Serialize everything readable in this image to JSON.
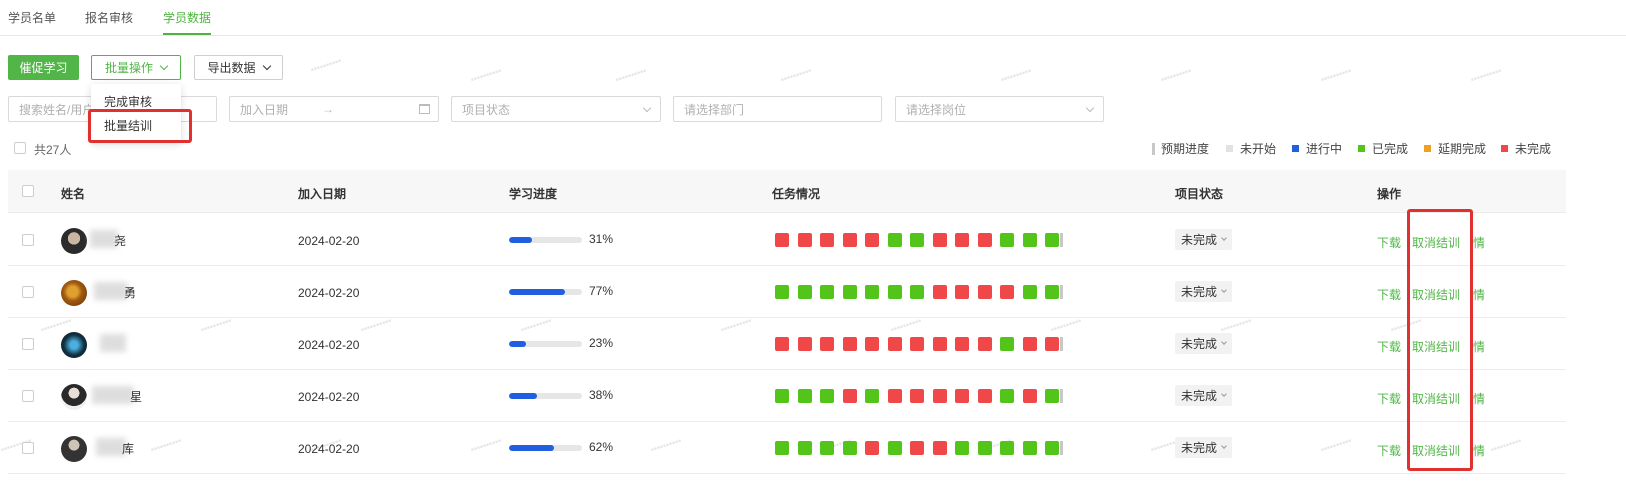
{
  "tabs": [
    {
      "label": "学员名单",
      "active": false
    },
    {
      "label": "报名审核",
      "active": false
    },
    {
      "label": "学员数据",
      "active": true
    }
  ],
  "toolbar": {
    "remind_label": "催促学习",
    "batch_label": "批量操作",
    "export_label": "导出数据"
  },
  "batch_menu": {
    "items": [
      "完成审核",
      "批量结训"
    ]
  },
  "filters": {
    "search_placeholder": "搜索姓名/用户",
    "date_placeholder": "加入日期",
    "date_separator": "→",
    "status_placeholder": "项目状态",
    "dept_placeholder": "请选择部门",
    "post_placeholder": "请选择岗位"
  },
  "summary": {
    "count_label": "共27人"
  },
  "legend": {
    "expected": "预期进度",
    "items": [
      {
        "label": "未开始",
        "color": "#e2e2e2"
      },
      {
        "label": "进行中",
        "color": "#1f5fe0"
      },
      {
        "label": "已完成",
        "color": "#52c41a"
      },
      {
        "label": "延期完成",
        "color": "#f0a020"
      },
      {
        "label": "未完成",
        "color": "#f04848"
      }
    ]
  },
  "colors": {
    "accent": "#52b548",
    "done": "#52c41a",
    "undone": "#f04848",
    "progress": "#1f5fe0",
    "highlight": "#e03030"
  },
  "table": {
    "columns": [
      "姓名",
      "加入日期",
      "学习进度",
      "任务情况",
      "项目状态",
      "操作"
    ],
    "rows": [
      {
        "name_suffix": "尧",
        "date": "2024-02-20",
        "progress": 31,
        "progress_label": "31%",
        "tasks": [
          "r",
          "r",
          "r",
          "r",
          "r",
          "g",
          "g",
          "r",
          "r",
          "r",
          "g",
          "g",
          "g"
        ],
        "status": "未完成",
        "actions": [
          "下载",
          "取消结训",
          "详情"
        ]
      },
      {
        "name_suffix": "勇",
        "date": "2024-02-20",
        "progress": 77,
        "progress_label": "77%",
        "tasks": [
          "g",
          "g",
          "g",
          "g",
          "g",
          "g",
          "g",
          "r",
          "r",
          "r",
          "r",
          "g",
          "g"
        ],
        "status": "未完成",
        "actions": [
          "下载",
          "取消结训",
          "详情"
        ]
      },
      {
        "name_suffix": "",
        "date": "2024-02-20",
        "progress": 23,
        "progress_label": "23%",
        "tasks": [
          "r",
          "r",
          "r",
          "r",
          "r",
          "r",
          "r",
          "r",
          "r",
          "r",
          "g",
          "r",
          "r"
        ],
        "status": "未完成",
        "actions": [
          "下载",
          "取消结训",
          "详情"
        ]
      },
      {
        "name_suffix": "星",
        "date": "2024-02-20",
        "progress": 38,
        "progress_label": "38%",
        "tasks": [
          "g",
          "g",
          "g",
          "r",
          "g",
          "r",
          "r",
          "r",
          "r",
          "r",
          "g",
          "r",
          "g"
        ],
        "status": "未完成",
        "actions": [
          "下载",
          "取消结训",
          "详情"
        ]
      },
      {
        "name_suffix": "库",
        "date": "2024-02-20",
        "progress": 62,
        "progress_label": "62%",
        "tasks": [
          "g",
          "g",
          "g",
          "g",
          "r",
          "g",
          "r",
          "r",
          "g",
          "g",
          "g",
          "g",
          "g"
        ],
        "status": "未完成",
        "actions": [
          "下载",
          "取消结训",
          "详情"
        ]
      }
    ]
  }
}
